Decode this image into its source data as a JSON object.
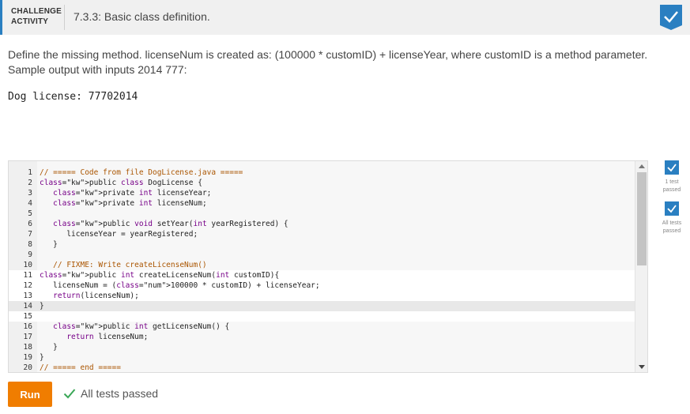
{
  "header": {
    "tag_line1": "CHALLENGE",
    "tag_line2": "ACTIVITY",
    "title": "7.3.3: Basic class definition."
  },
  "description": {
    "line1": "Define the missing method. licenseNum is created as: (100000 * customID) + licenseYear, where customID is a method parameter.",
    "line2": "Sample output with inputs 2014 777:"
  },
  "sample_output": "Dog license: 77702014",
  "editor": {
    "lines": [
      {
        "n": "1",
        "text": "// ===== Code from file DogLicense.java ====="
      },
      {
        "n": "2",
        "text": "public class DogLicense {"
      },
      {
        "n": "3",
        "text": "   private int licenseYear;"
      },
      {
        "n": "4",
        "text": "   private int licenseNum;"
      },
      {
        "n": "5",
        "text": ""
      },
      {
        "n": "6",
        "text": "   public void setYear(int yearRegistered) {"
      },
      {
        "n": "7",
        "text": "      licenseYear = yearRegistered;"
      },
      {
        "n": "8",
        "text": "   }"
      },
      {
        "n": "9",
        "text": ""
      },
      {
        "n": "10",
        "text": "   // FIXME: Write createLicenseNum()"
      },
      {
        "n": "11",
        "text": "public int createLicenseNum(int customID){"
      },
      {
        "n": "12",
        "text": "   licenseNum = (100000 * customID) + licenseYear;"
      },
      {
        "n": "13",
        "text": "   return(licenseNum);"
      },
      {
        "n": "14",
        "text": "}"
      },
      {
        "n": "15",
        "text": ""
      },
      {
        "n": "16",
        "text": "   public int getLicenseNum() {"
      },
      {
        "n": "17",
        "text": "      return licenseNum;"
      },
      {
        "n": "18",
        "text": "   }"
      },
      {
        "n": "19",
        "text": "}"
      },
      {
        "n": "20",
        "text": "// ===== end ====="
      }
    ],
    "highlight_line": 14
  },
  "side_checks": {
    "check1_line1": "1 test",
    "check1_line2": "passed",
    "check2_line1": "All tests",
    "check2_line2": "passed"
  },
  "run_label": "Run",
  "status_text": "All tests passed",
  "colors": {
    "accent_blue": "#2a7fc1",
    "run_orange": "#f07d00",
    "pass_green": "#3aa757"
  }
}
